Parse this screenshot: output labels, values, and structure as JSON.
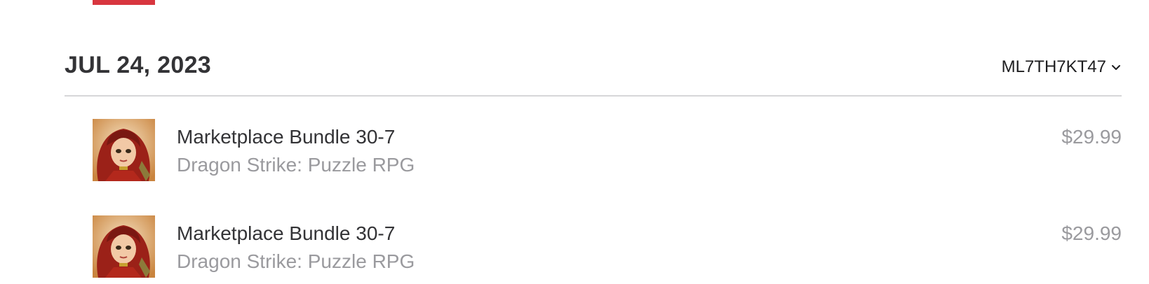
{
  "colors": {
    "accent_red": "#d8363f",
    "text_primary": "#333336",
    "text_secondary": "#9a9a9e",
    "divider": "#d6d6d8"
  },
  "purchase_group": {
    "date": "JUL 24, 2023",
    "order_id": "ML7TH7KT47",
    "order_icon": "chevron-down-icon"
  },
  "items": [
    {
      "title": "Marketplace Bundle 30-7",
      "app": "Dragon Strike: Puzzle RPG",
      "price": "$29.99",
      "icon": "game-character-artwork"
    },
    {
      "title": "Marketplace Bundle 30-7",
      "app": "Dragon Strike: Puzzle RPG",
      "price": "$29.99",
      "icon": "game-character-artwork"
    }
  ]
}
